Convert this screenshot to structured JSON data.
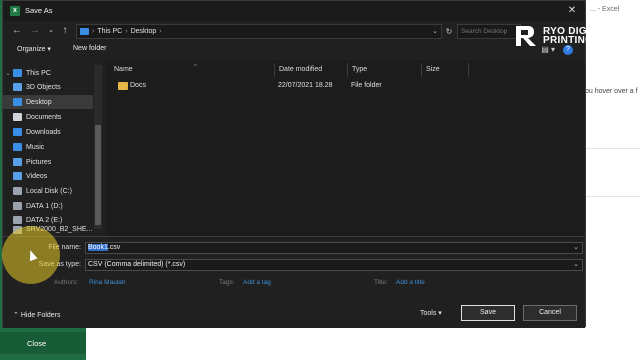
{
  "background": {
    "app_title": "...  -  Excel",
    "hint_text": "ou hover over a f",
    "close_label": "Close"
  },
  "watermark": {
    "line1": "RYO DIGITAL",
    "line2": "PRINTING"
  },
  "dialog": {
    "title": "Save As",
    "breadcrumb": [
      "This PC",
      "Desktop"
    ],
    "search_placeholder": "Search Desktop",
    "toolbar": {
      "organize": "Organize",
      "new_folder": "New folder"
    },
    "nav_items": [
      {
        "label": "This PC",
        "icon": "pc-icon",
        "color": "#3a8ee6"
      },
      {
        "label": "3D Objects",
        "icon": "cube-icon",
        "color": "#5aa0e8"
      },
      {
        "label": "Desktop",
        "icon": "desktop-icon",
        "color": "#3a8ee6"
      },
      {
        "label": "Documents",
        "icon": "documents-icon",
        "color": "#cfd4da"
      },
      {
        "label": "Downloads",
        "icon": "download-icon",
        "color": "#3a8ee6"
      },
      {
        "label": "Music",
        "icon": "music-icon",
        "color": "#3a8ee6"
      },
      {
        "label": "Pictures",
        "icon": "pictures-icon",
        "color": "#5aa0e8"
      },
      {
        "label": "Videos",
        "icon": "videos-icon",
        "color": "#5aa0e8"
      },
      {
        "label": "Local Disk (C:)",
        "icon": "drive-icon",
        "color": "#9aa3ad"
      },
      {
        "label": "DATA 1 (D:)",
        "icon": "drive-icon",
        "color": "#9aa3ad"
      },
      {
        "label": "DATA 2 (E:)",
        "icon": "drive-icon",
        "color": "#9aa3ad"
      },
      {
        "label": "SRV2000_B2_SHE...",
        "icon": "network-drive-icon",
        "color": "#9aa3ad"
      }
    ],
    "columns": {
      "name": "Name",
      "date": "Date modified",
      "type": "Type",
      "size": "Size"
    },
    "files": [
      {
        "name": "Docs",
        "date": "22/07/2021 18.28",
        "type": "File folder",
        "size": ""
      }
    ],
    "file_name": {
      "label": "File name:",
      "value_selected": "Book1",
      "value_rest": ".csv"
    },
    "save_as_type": {
      "label": "Save as type:",
      "value": "CSV (Comma delimited) (*.csv)"
    },
    "authors": {
      "label": "Authors:",
      "value": "Rina Maulah"
    },
    "tags": {
      "label": "Tags:",
      "value": "Add a tag"
    },
    "doc_title": {
      "label": "Title:",
      "value": "Add a title"
    },
    "hide_folders": "Hide Folders",
    "tools": "Tools",
    "save": "Save",
    "cancel": "Cancel"
  }
}
